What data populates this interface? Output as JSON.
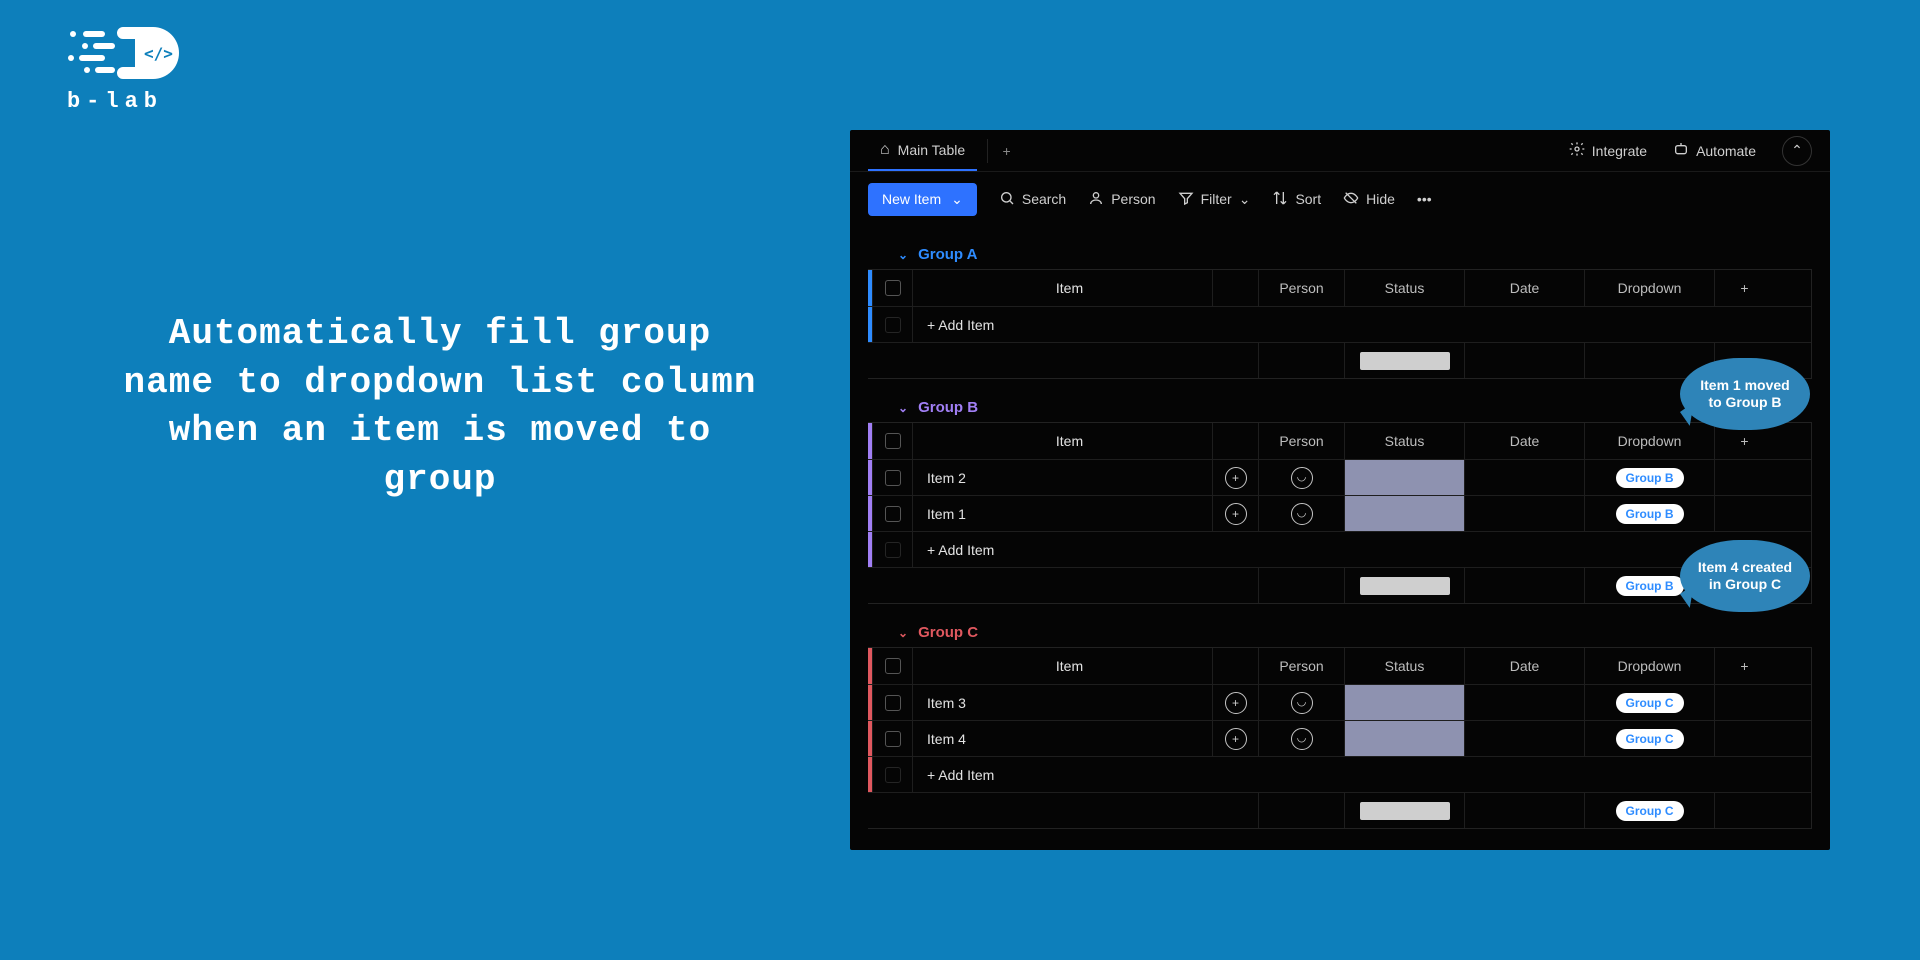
{
  "logo": {
    "text": "b-lab"
  },
  "headline": "Automatically fill group name to dropdown list column when an item is moved to group",
  "tabs": {
    "main": "Main Table",
    "integrate": "Integrate",
    "automate": "Automate"
  },
  "toolbar": {
    "new_item": "New Item",
    "search": "Search",
    "person": "Person",
    "filter": "Filter",
    "sort": "Sort",
    "hide": "Hide"
  },
  "columns": {
    "item": "Item",
    "person": "Person",
    "status": "Status",
    "date": "Date",
    "dropdown": "Dropdown"
  },
  "add_item_label": "+ Add Item",
  "groups": [
    {
      "id": "group-a",
      "title": "Group A",
      "color_class": "g-blue",
      "rows": [],
      "summary_dropdown": ""
    },
    {
      "id": "group-b",
      "title": "Group B",
      "color_class": "g-purple",
      "rows": [
        {
          "name": "Item 2",
          "dd": "Group B"
        },
        {
          "name": "Item 1",
          "dd": "Group B"
        }
      ],
      "summary_dropdown": "Group B"
    },
    {
      "id": "group-c",
      "title": "Group C",
      "color_class": "g-red",
      "rows": [
        {
          "name": "Item 3",
          "dd": "Group C"
        },
        {
          "name": "Item 4",
          "dd": "Group C"
        }
      ],
      "summary_dropdown": "Group C"
    }
  ],
  "bubbles": {
    "b1": "Item 1 moved to Group B",
    "b2": "Item 4 created in Group C"
  }
}
